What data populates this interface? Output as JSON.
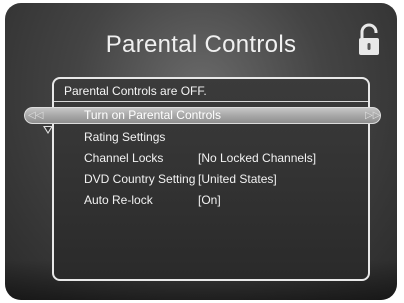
{
  "screen": {
    "title": "Parental Controls",
    "lock_icon": "unlocked-padlock-icon",
    "status": "Parental Controls are OFF."
  },
  "menu": {
    "items": [
      {
        "label": "Turn on Parental Controls",
        "value": ""
      },
      {
        "label": "Rating Settings",
        "value": ""
      },
      {
        "label": "Channel Locks",
        "value": "[No Locked Channels]"
      },
      {
        "label": "DVD Country Setting",
        "value": "[United States]"
      },
      {
        "label": "Auto Re-lock",
        "value": "[On]"
      }
    ],
    "selected_index": 0
  },
  "colors": {
    "background": "#444444",
    "highlight": "#b0b0b0",
    "text": "#f2f2f2"
  }
}
